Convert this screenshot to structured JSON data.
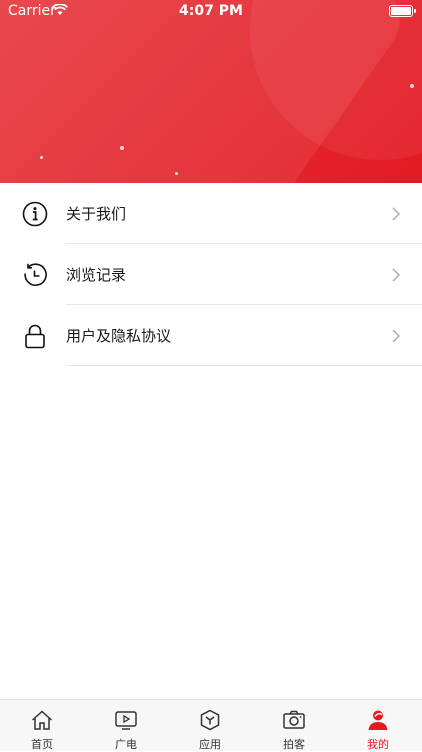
{
  "status_bar": {
    "carrier": "Carrier",
    "time": "4:07 PM"
  },
  "menu": {
    "items": [
      {
        "label": "关于我们",
        "icon": "info-icon"
      },
      {
        "label": "浏览记录",
        "icon": "history-icon"
      },
      {
        "label": "用户及隐私协议",
        "icon": "lock-icon"
      }
    ]
  },
  "tabs": [
    {
      "label": "首页",
      "icon": "home-icon"
    },
    {
      "label": "广电",
      "icon": "tv-icon"
    },
    {
      "label": "应用",
      "icon": "app-cube-icon"
    },
    {
      "label": "拍客",
      "icon": "camera-icon"
    },
    {
      "label": "我的",
      "icon": "user-icon",
      "active": true
    }
  ],
  "colors": {
    "accent": "#e31b23",
    "header": "#e42a31",
    "divider": "#e6e6e6"
  }
}
